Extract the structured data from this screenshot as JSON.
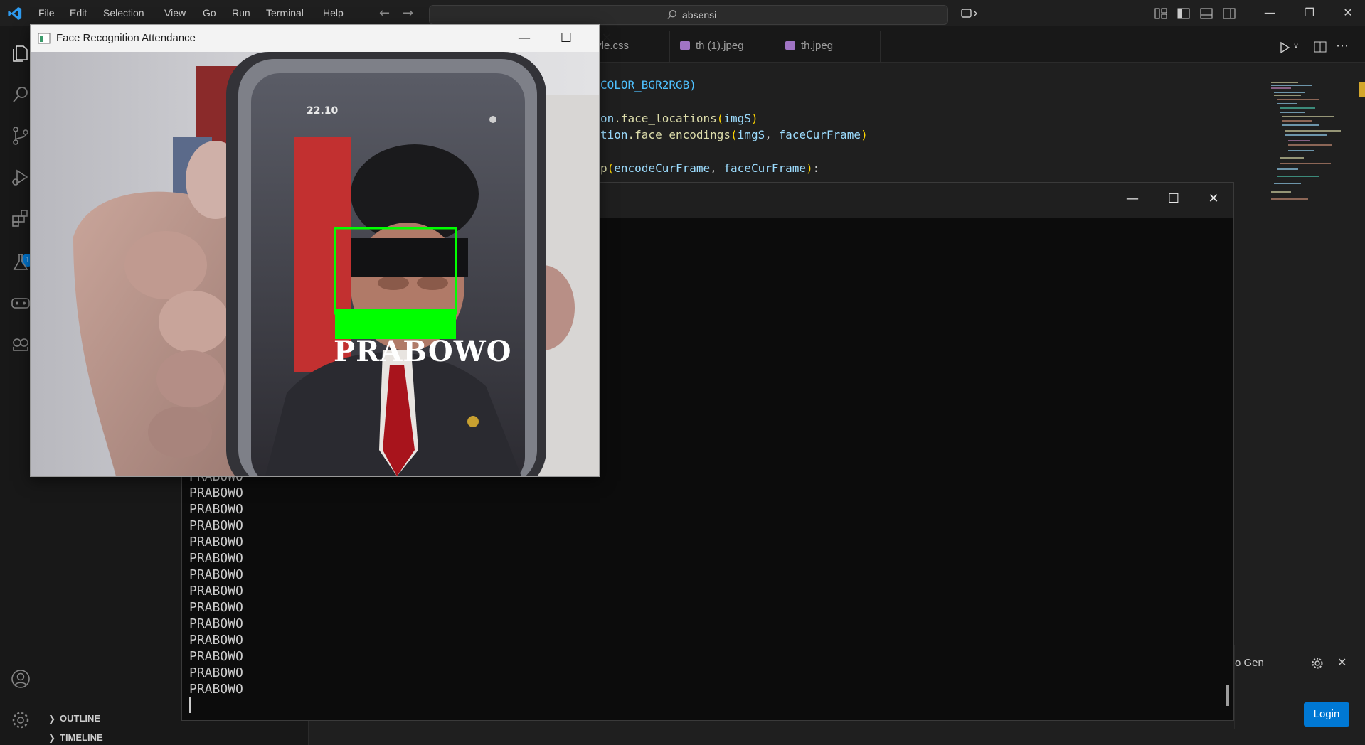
{
  "menu": [
    "File",
    "Edit",
    "Selection",
    "View",
    "Go",
    "Run",
    "Terminal",
    "Help"
  ],
  "search": {
    "text": "absensi"
  },
  "tabs": [
    "tyle.css",
    "th (1).jpeg",
    "th.jpeg"
  ],
  "activity_badge": "1",
  "sidebar": {
    "outline_label": "OUTLINE",
    "timeline_label": "TIMELINE"
  },
  "code_lines": {
    "line1": "COLOR_BGR2RGB)",
    "line2_fn": ".face_locations",
    "line2_arg": "imgS",
    "line3_fn": ".face_encodings",
    "line3_arg1": "imgS",
    "line3_arg2": "faceCurFrame",
    "line4_arg1": "encodeCurFrame",
    "line4_arg2": "faceCurFrame"
  },
  "console": {
    "lines": [
      "PRABOWO",
      "PRABOWO",
      "PRABOWO",
      "PRABOWO",
      "PRABOWO",
      "PRABOWO",
      "PRABOWO",
      "PRABOWO",
      "PRABOWO",
      "PRABOWO",
      "PRABOWO",
      "PRABOWO",
      "PRABOWO",
      "PRABOWO"
    ]
  },
  "notification": {
    "text": "o Gen",
    "login_label": "Login"
  },
  "camera_window": {
    "title": "Face Recognition Attendance",
    "face_label": "PRABOWO",
    "phone_time": "22.10"
  },
  "colors": {
    "accent": "#0078d4",
    "detection_box": "#00ff00",
    "editor_bg": "#1f1f1f",
    "console_bg": "#0c0c0c"
  }
}
